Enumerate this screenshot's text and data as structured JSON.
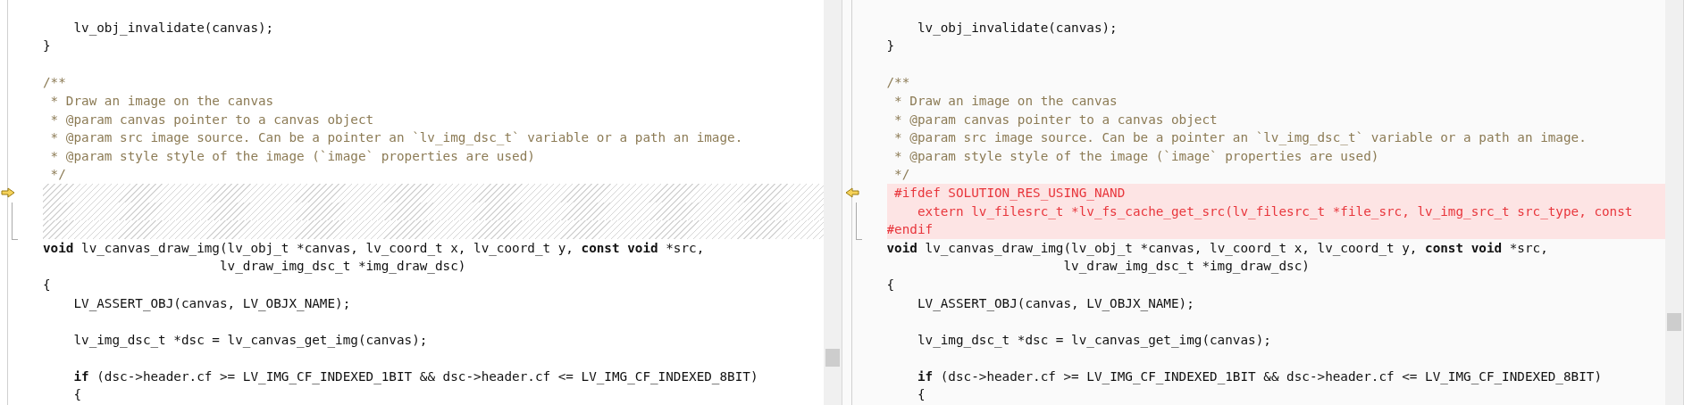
{
  "panes": [
    {
      "lines": [
        {
          "kind": "blank"
        },
        {
          "kind": "code",
          "text": "    lv_obj_invalidate(canvas);"
        },
        {
          "kind": "code",
          "text": "}"
        },
        {
          "kind": "blank"
        },
        {
          "kind": "comment",
          "text": "/**"
        },
        {
          "kind": "comment",
          "text": " * Draw an image on the canvas"
        },
        {
          "kind": "comment",
          "text": " * @param canvas pointer to a canvas object"
        },
        {
          "kind": "comment",
          "text": " * @param src image source. Can be a pointer an `lv_img_dsc_t` variable or a path an image."
        },
        {
          "kind": "comment",
          "text": " * @param style style of the image (`image` properties are used)"
        },
        {
          "kind": "comment",
          "text": " */"
        },
        {
          "kind": "gap"
        },
        {
          "kind": "gap"
        },
        {
          "kind": "gap"
        },
        {
          "kind": "code",
          "text": "**void** lv_canvas_draw_img(lv_obj_t *canvas, lv_coord_t x, lv_coord_t y, **const void** *src,"
        },
        {
          "kind": "code",
          "text": "                       lv_draw_img_dsc_t *img_draw_dsc)"
        },
        {
          "kind": "code",
          "text": "{"
        },
        {
          "kind": "code",
          "text": "    LV_ASSERT_OBJ(canvas, LV_OBJX_NAME);"
        },
        {
          "kind": "blank"
        },
        {
          "kind": "code",
          "text": "    lv_img_dsc_t *dsc = lv_canvas_get_img(canvas);"
        },
        {
          "kind": "blank"
        },
        {
          "kind": "code",
          "text": "    **if** (dsc->header.cf >= LV_IMG_CF_INDEXED_1BIT && dsc->header.cf <= LV_IMG_CF_INDEXED_8BIT)"
        },
        {
          "kind": "code",
          "text": "    {"
        }
      ]
    },
    {
      "lines": [
        {
          "kind": "blank"
        },
        {
          "kind": "code",
          "text": "    lv_obj_invalidate(canvas);"
        },
        {
          "kind": "code",
          "text": "}"
        },
        {
          "kind": "blank"
        },
        {
          "kind": "comment",
          "text": "/**"
        },
        {
          "kind": "comment",
          "text": " * Draw an image on the canvas"
        },
        {
          "kind": "comment",
          "text": " * @param canvas pointer to a canvas object"
        },
        {
          "kind": "comment",
          "text": " * @param src image source. Can be a pointer an `lv_img_dsc_t` variable or a path an image."
        },
        {
          "kind": "comment",
          "text": " * @param style style of the image (`image` properties are used)"
        },
        {
          "kind": "comment",
          "text": " */"
        },
        {
          "kind": "added",
          "text": " #ifdef SOLUTION_RES_USING_NAND"
        },
        {
          "kind": "added",
          "text": "    extern lv_filesrc_t *lv_fs_cache_get_src(lv_filesrc_t *file_src, lv_img_src_t src_type, const"
        },
        {
          "kind": "added",
          "text": "#endif"
        },
        {
          "kind": "code",
          "text": "**void** lv_canvas_draw_img(lv_obj_t *canvas, lv_coord_t x, lv_coord_t y, **const void** *src,"
        },
        {
          "kind": "code",
          "text": "                       lv_draw_img_dsc_t *img_draw_dsc)"
        },
        {
          "kind": "code",
          "text": "{"
        },
        {
          "kind": "code",
          "text": "    LV_ASSERT_OBJ(canvas, LV_OBJX_NAME);"
        },
        {
          "kind": "blank"
        },
        {
          "kind": "code",
          "text": "    lv_img_dsc_t *dsc = lv_canvas_get_img(canvas);"
        },
        {
          "kind": "blank"
        },
        {
          "kind": "code",
          "text": "    **if** (dsc->header.cf >= LV_IMG_CF_INDEXED_1BIT && dsc->header.cf <= LV_IMG_CF_INDEXED_8BIT)"
        },
        {
          "kind": "code",
          "text": "    {"
        }
      ]
    }
  ]
}
